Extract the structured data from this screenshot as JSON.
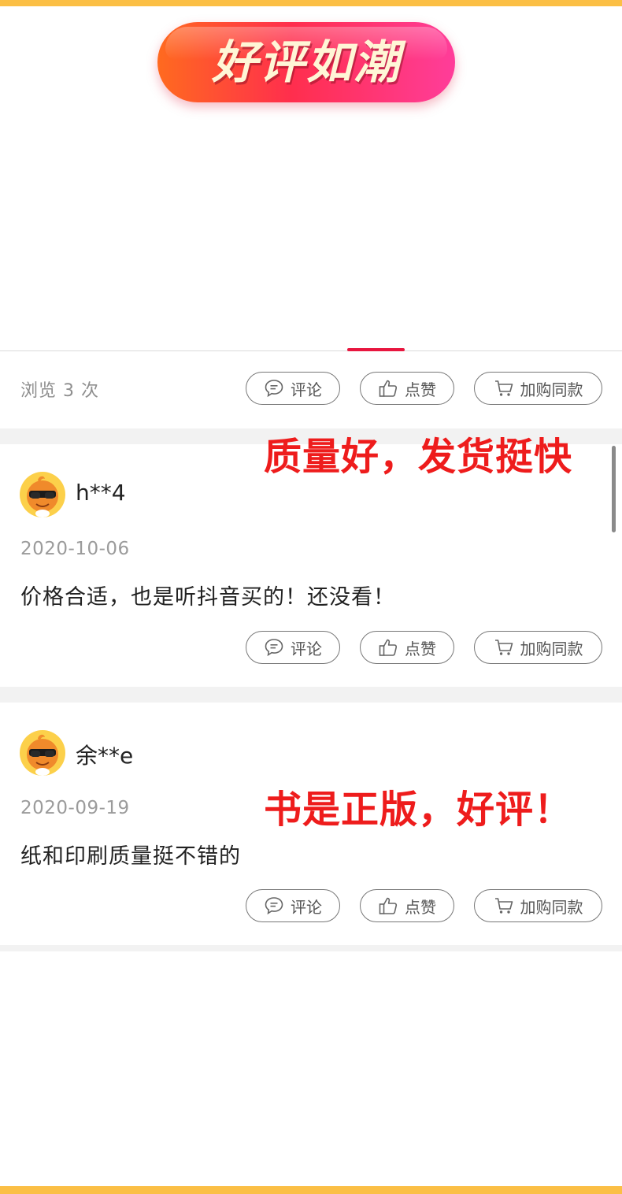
{
  "banner": {
    "title": "好评如潮"
  },
  "post": {
    "views_text": "浏览 3 次"
  },
  "actions": {
    "comment": "评论",
    "like": "点赞",
    "cart": "加购同款"
  },
  "captions": {
    "first": "质量好，发货挺快",
    "second": "书是正版，好评！"
  },
  "reviews": [
    {
      "username": "h**4",
      "date": "2020-10-06",
      "text": "价格合适，也是听抖音买的！还没看！"
    },
    {
      "username": "余**e",
      "date": "2020-09-19",
      "text": "纸和印刷质量挺不错的"
    }
  ],
  "icons": {
    "comment": "speech-bubble-icon",
    "like": "thumbs-up-icon",
    "cart": "shopping-cart-icon"
  },
  "colors": {
    "frame": "#fbbf45",
    "accent_red": "#e8163f",
    "caption_red": "#ee1c1c"
  }
}
